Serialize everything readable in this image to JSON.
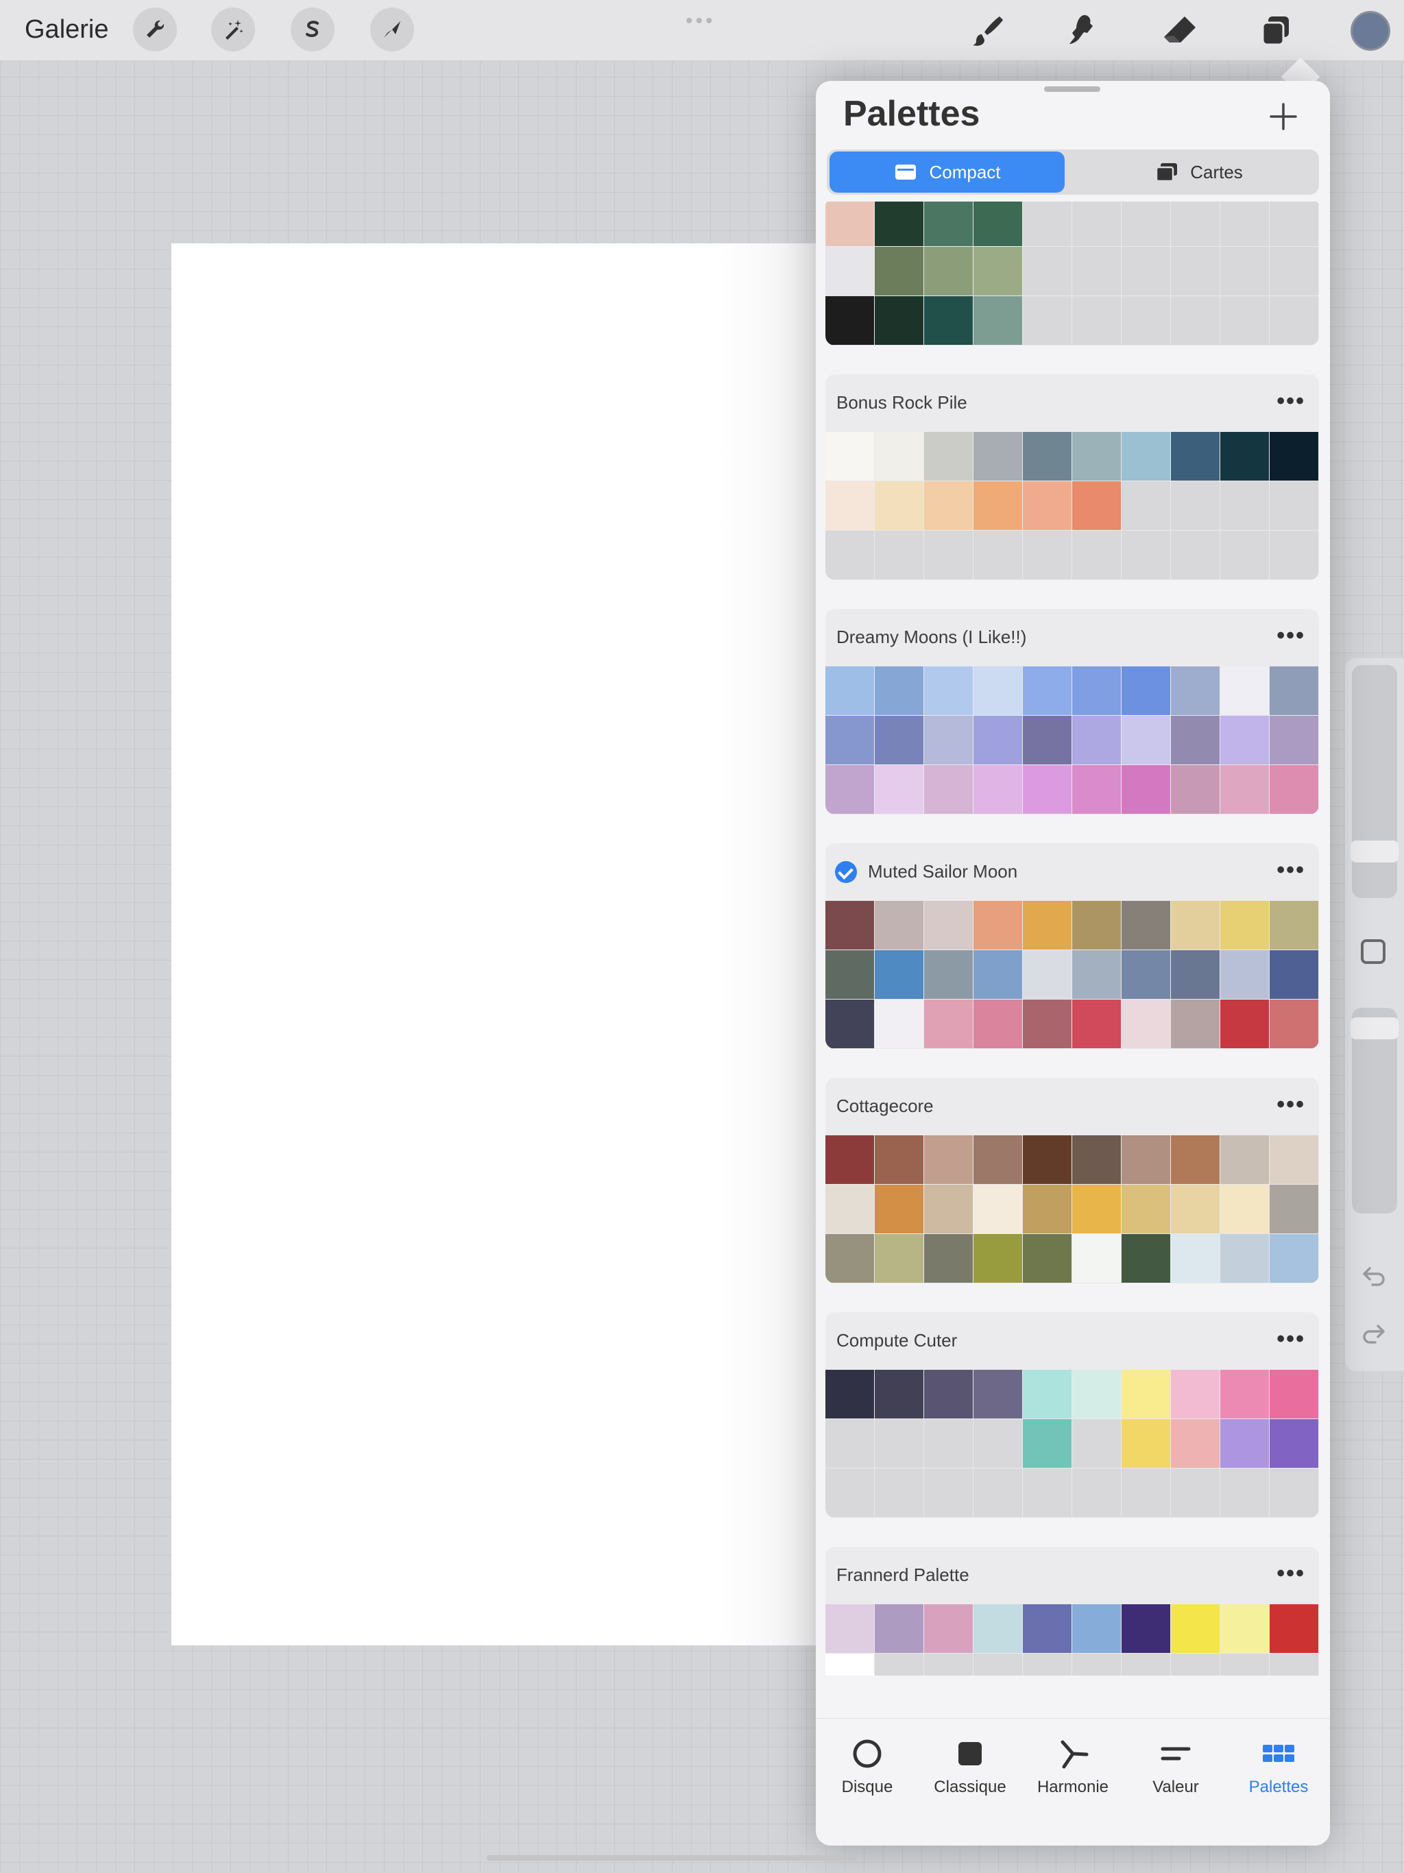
{
  "topbar": {
    "gallery_label": "Galerie",
    "left_tools": [
      "wrench-icon",
      "magic-wand-icon",
      "selection-s-icon",
      "transform-arrow-icon"
    ],
    "right_tools": [
      "brush-icon",
      "smudge-icon",
      "eraser-icon",
      "layers-icon"
    ],
    "current_color": "#6b7a96"
  },
  "panel": {
    "title": "Palettes",
    "add_icon": "plus-icon",
    "tabs": [
      {
        "label": "Compact",
        "icon": "compact-card-icon",
        "active": true
      },
      {
        "label": "Cartes",
        "icon": "cards-icon",
        "active": false
      }
    ]
  },
  "palettes": [
    {
      "name": "",
      "partial": true,
      "colors": [
        "#e9c4b6",
        "#213d2d",
        "#4a7662",
        "#3c6a52",
        "",
        "",
        "",
        "",
        "",
        "",
        "#e5e5ea",
        "#6b7d5b",
        "#8c9d7a",
        "#9aab86",
        "",
        "",
        "",
        "",
        "",
        "",
        "#1d1d1e",
        "#1b3329",
        "#21504a",
        "#7d9c92",
        "",
        "",
        "",
        "",
        "",
        ""
      ]
    },
    {
      "name": "Bonus Rock Pile",
      "selected": false,
      "colors": [
        "#f7f6f3",
        "#f0efe9",
        "#cbccc8",
        "#a8adb4",
        "#6f8592",
        "#9bb3b8",
        "#9ac0d2",
        "#3c607c",
        "#143640",
        "#0c1f2c",
        "#f6e6d9",
        "#f3dfbb",
        "#f3cda6",
        "#eeab78",
        "#f0ab8e",
        "#e88a6b",
        "",
        "",
        "",
        "",
        "",
        "",
        "",
        "",
        "",
        "",
        "",
        "",
        "",
        ""
      ]
    },
    {
      "name": "Dreamy Moons (I Like!!)",
      "selected": false,
      "colors": [
        "#9ebde7",
        "#86a7d6",
        "#b2c9ee",
        "#ccdaf2",
        "#8eacea",
        "#7f9ee3",
        "#6c91e0",
        "#9eaccd",
        "#eeeef4",
        "#909db9",
        "#8597ce",
        "#7883ba",
        "#b5b9da",
        "#9ea1dd",
        "#7673a2",
        "#ada8e2",
        "#cbc7ec",
        "#938ab0",
        "#c0b4ea",
        "#ab9bc2",
        "#c1a5cf",
        "#e6ccec",
        "#d5b4d6",
        "#e0b4e5",
        "#dc9be0",
        "#d98bcb",
        "#d478c2",
        "#c899b5",
        "#dfa6c2",
        "#dc8db0"
      ]
    },
    {
      "name": "Muted Sailor Moon",
      "selected": true,
      "colors": [
        "#7b4a4c",
        "#c0b3b1",
        "#d7c9c8",
        "#e7a07e",
        "#e2a84d",
        "#ad9563",
        "#868079",
        "#e3cf9c",
        "#e6d073",
        "#bab283",
        "#5f6b62",
        "#4f8ac3",
        "#8c9aa5",
        "#7fa0cb",
        "#d9dde3",
        "#a2b0bf",
        "#7487a7",
        "#697792",
        "#b7c0d7",
        "#4f6194",
        "#424359",
        "#f1eff3",
        "#e0a1b4",
        "#da859d",
        "#a9646c",
        "#d14a5b",
        "#ead8dc",
        "#b5a3a4",
        "#c63940",
        "#d07171"
      ]
    },
    {
      "name": "Cottagecore",
      "selected": false,
      "colors": [
        "#8c3b3a",
        "#9a634f",
        "#c29e8f",
        "#9b7868",
        "#633c29",
        "#6e5a4e",
        "#b09080",
        "#b07a58",
        "#c8beb4",
        "#ddd1c6",
        "#e4ddd3",
        "#d38f45",
        "#cdbaa0",
        "#f5ebdd",
        "#c09f61",
        "#e8b54a",
        "#dbc07b",
        "#e7d4a2",
        "#f5e6c3",
        "#a9a49d",
        "#96927e",
        "#b7b485",
        "#7a7a6a",
        "#999b3f",
        "#6f784c",
        "#f2f5f1",
        "#435942",
        "#dde7ee",
        "#c3d0dc",
        "#a6c2df"
      ]
    },
    {
      "name": "Compute Cuter",
      "selected": false,
      "colors": [
        "#313145",
        "#414054",
        "#585471",
        "#6d6888",
        "#ade3dd",
        "#d5ede7",
        "#f8ec8f",
        "#f2bbd1",
        "#ed8ab4",
        "#e96d9d",
        "",
        "",
        "",
        "",
        "#72c4b8",
        "",
        "#f3d766",
        "#edb2b1",
        "#ad95e2",
        "#8063c3",
        "",
        "",
        "",
        "",
        "",
        "",
        "",
        "",
        "",
        ""
      ]
    },
    {
      "name": "Frannerd Palette",
      "selected": false,
      "colors": [
        "#dfcde2",
        "#ae9bc2",
        "#d8a2bf",
        "#c3dce1",
        "#6a6fb0",
        "#86acd9",
        "#3e2d75",
        "#f3e54a",
        "#f5f09c",
        "#cd3233",
        "#ffffff",
        "",
        "",
        "",
        "",
        "",
        "",
        "",
        "",
        "",
        "",
        "",
        "",
        "",
        "",
        "",
        "",
        "",
        "",
        ""
      ]
    }
  ],
  "card_more_label": "•••",
  "bottom_tabs": [
    {
      "label": "Disque",
      "icon": "disc-icon",
      "active": false
    },
    {
      "label": "Classique",
      "icon": "classic-square-icon",
      "active": false
    },
    {
      "label": "Harmonie",
      "icon": "harmony-icon",
      "active": false
    },
    {
      "label": "Valeur",
      "icon": "value-sliders-icon",
      "active": false
    },
    {
      "label": "Palettes",
      "icon": "palettes-grid-icon",
      "active": true
    }
  ],
  "colors": {
    "accent": "#3c8bf5",
    "empty_swatch": "#d8d8da"
  }
}
